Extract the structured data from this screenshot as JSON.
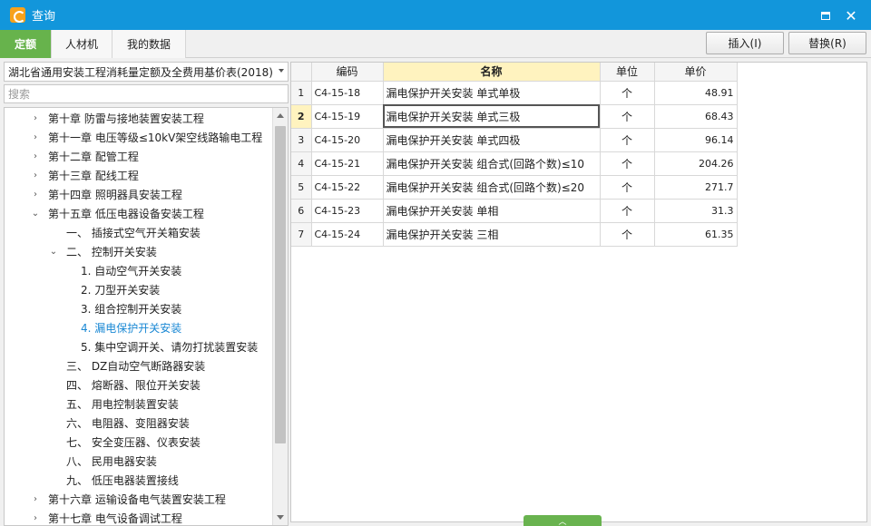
{
  "window": {
    "title": "查询",
    "maximize_icon": "maximize-icon",
    "close_icon": "close-icon",
    "close_glyph": "✕"
  },
  "tabs": [
    {
      "label": "定额",
      "active": true
    },
    {
      "label": "人材机",
      "active": false
    },
    {
      "label": "我的数据",
      "active": false
    }
  ],
  "toolbar": {
    "insert_label": "插入(I)",
    "replace_label": "替换(R)"
  },
  "library": {
    "selected": "湖北省通用安装工程消耗量定额及全费用基价表(2018)"
  },
  "search": {
    "placeholder": "搜索",
    "value": ""
  },
  "tree": [
    {
      "label": "第十章 防雷与接地装置安装工程",
      "chevron": "›",
      "level": 0
    },
    {
      "label": "第十一章 电压等级≤10kV架空线路输电工程",
      "chevron": "›",
      "level": 0
    },
    {
      "label": "第十二章 配管工程",
      "chevron": "›",
      "level": 0
    },
    {
      "label": "第十三章 配线工程",
      "chevron": "›",
      "level": 0
    },
    {
      "label": "第十四章 照明器具安装工程",
      "chevron": "›",
      "level": 0
    },
    {
      "label": "第十五章 低压电器设备安装工程",
      "chevron": "⌄",
      "level": 0
    },
    {
      "label": "一、 插接式空气开关箱安装",
      "chevron": "",
      "level": 1
    },
    {
      "label": "二、 控制开关安装",
      "chevron": "⌄",
      "level": 1
    },
    {
      "label": "1. 自动空气开关安装",
      "chevron": "",
      "level": 2
    },
    {
      "label": "2. 刀型开关安装",
      "chevron": "",
      "level": 2
    },
    {
      "label": "3. 组合控制开关安装",
      "chevron": "",
      "level": 2
    },
    {
      "label": "4. 漏电保护开关安装",
      "chevron": "",
      "level": 2,
      "selected": true
    },
    {
      "label": "5. 集中空调开关、请勿打扰装置安装",
      "chevron": "",
      "level": 2
    },
    {
      "label": "三、 DZ自动空气断路器安装",
      "chevron": "",
      "level": 1
    },
    {
      "label": "四、 熔断器、限位开关安装",
      "chevron": "",
      "level": 1
    },
    {
      "label": "五、 用电控制装置安装",
      "chevron": "",
      "level": 1
    },
    {
      "label": "六、 电阻器、变阻器安装",
      "chevron": "",
      "level": 1
    },
    {
      "label": "七、 安全变压器、仪表安装",
      "chevron": "",
      "level": 1
    },
    {
      "label": "八、 民用电器安装",
      "chevron": "",
      "level": 1
    },
    {
      "label": "九、 低压电器装置接线",
      "chevron": "",
      "level": 1
    },
    {
      "label": "第十六章 运输设备电气装置安装工程",
      "chevron": "›",
      "level": 0
    },
    {
      "label": "第十七章 电气设备调试工程",
      "chevron": "›",
      "level": 0
    }
  ],
  "grid": {
    "headers": {
      "code": "编码",
      "name": "名称",
      "unit": "单位",
      "price": "单价"
    },
    "rows": [
      {
        "idx": "1",
        "code": "C4-15-18",
        "name": "漏电保护开关安装 单式单极",
        "unit": "个",
        "price": "48.91"
      },
      {
        "idx": "2",
        "code": "C4-15-19",
        "name": "漏电保护开关安装 单式三极",
        "unit": "个",
        "price": "68.43",
        "selected": true
      },
      {
        "idx": "3",
        "code": "C4-15-20",
        "name": "漏电保护开关安装 单式四极",
        "unit": "个",
        "price": "96.14"
      },
      {
        "idx": "4",
        "code": "C4-15-21",
        "name": "漏电保护开关安装 组合式(回路个数)≤10",
        "unit": "个",
        "price": "204.26"
      },
      {
        "idx": "5",
        "code": "C4-15-22",
        "name": "漏电保护开关安装 组合式(回路个数)≤20",
        "unit": "个",
        "price": "271.7"
      },
      {
        "idx": "6",
        "code": "C4-15-23",
        "name": "漏电保护开关安装 单相",
        "unit": "个",
        "price": "31.3"
      },
      {
        "idx": "7",
        "code": "C4-15-24",
        "name": "漏电保护开关安装 三相",
        "unit": "个",
        "price": "61.35"
      }
    ]
  },
  "collapse_handle": {
    "glyph": "︿"
  }
}
